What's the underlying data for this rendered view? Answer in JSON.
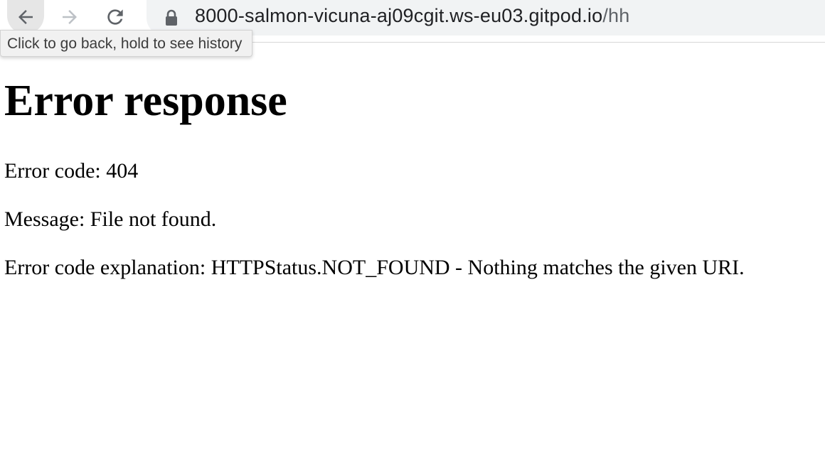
{
  "browser": {
    "tooltip": "Click to go back, hold to see history",
    "url_host": "8000-salmon-vicuna-aj09cgit.ws-eu03.gitpod.io",
    "url_path": "/hh",
    "icons": {
      "back": "arrow-left-icon",
      "forward": "arrow-right-icon",
      "reload": "reload-icon",
      "security": "lock-icon"
    }
  },
  "page": {
    "heading": "Error response",
    "error_code": "Error code: 404",
    "message": "Message: File not found.",
    "explanation": "Error code explanation: HTTPStatus.NOT_FOUND - Nothing matches the given URI."
  }
}
